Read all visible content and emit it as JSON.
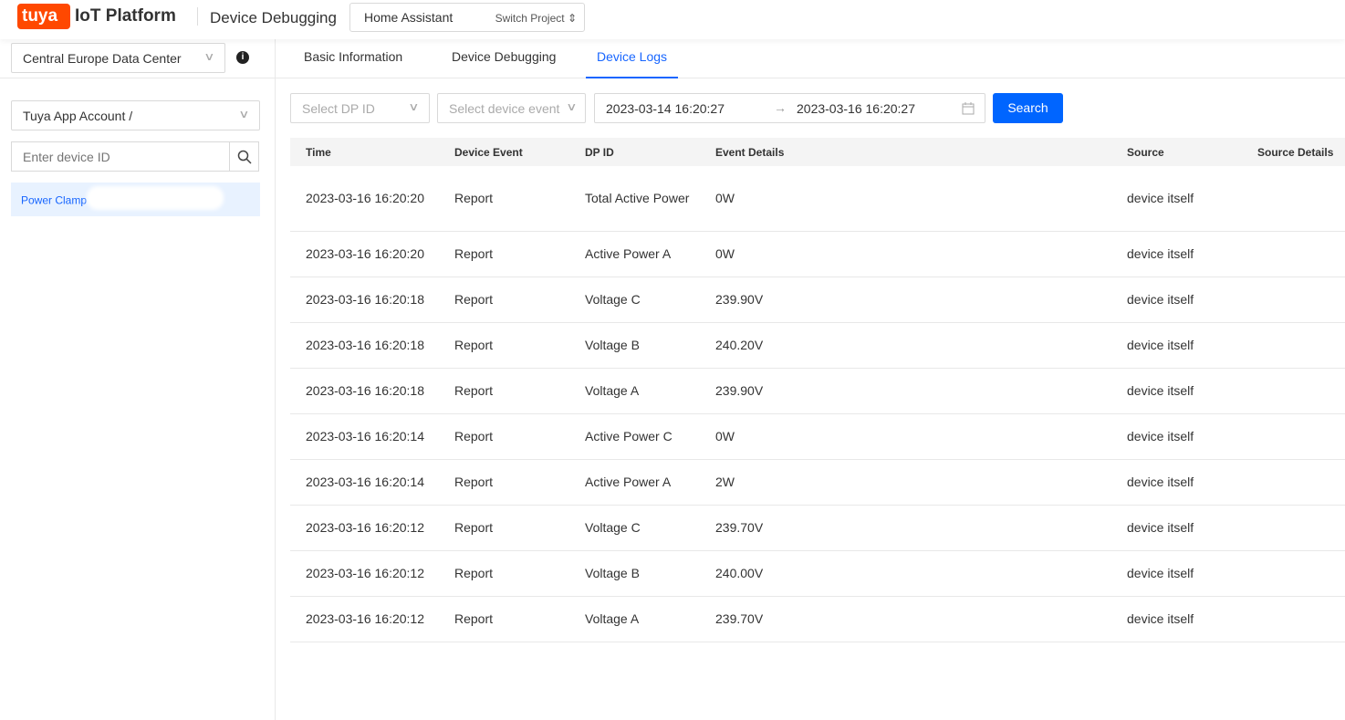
{
  "header": {
    "logo_text": "tuya",
    "brand": "IoT Platform",
    "page_title": "Device Debugging",
    "project": "Home Assistant",
    "switch_label": "Switch Project"
  },
  "sidebar": {
    "data_center": "Central Europe Data Center",
    "account": "Tuya App Account /",
    "device_id_placeholder": "Enter device ID",
    "device": "Power Clamp"
  },
  "tabs": [
    {
      "label": "Basic Information"
    },
    {
      "label": "Device Debugging"
    },
    {
      "label": "Device Logs"
    }
  ],
  "filters": {
    "dp_placeholder": "Select DP ID",
    "event_placeholder": "Select device event",
    "start": "2023-03-14 16:20:27",
    "end": "2023-03-16 16:20:27",
    "search": "Search"
  },
  "table": {
    "columns": [
      "Time",
      "Device Event",
      "DP ID",
      "Event Details",
      "Source",
      "Source Details"
    ],
    "rows": [
      [
        "2023-03-16 16:20:20",
        "Report",
        "Total Active Power",
        "0W",
        "device itself",
        ""
      ],
      [
        "2023-03-16 16:20:20",
        "Report",
        "Active Power A",
        "0W",
        "device itself",
        ""
      ],
      [
        "2023-03-16 16:20:18",
        "Report",
        "Voltage C",
        "239.90V",
        "device itself",
        ""
      ],
      [
        "2023-03-16 16:20:18",
        "Report",
        "Voltage B",
        "240.20V",
        "device itself",
        ""
      ],
      [
        "2023-03-16 16:20:18",
        "Report",
        "Voltage A",
        "239.90V",
        "device itself",
        ""
      ],
      [
        "2023-03-16 16:20:14",
        "Report",
        "Active Power C",
        "0W",
        "device itself",
        ""
      ],
      [
        "2023-03-16 16:20:14",
        "Report",
        "Active Power A",
        "2W",
        "device itself",
        ""
      ],
      [
        "2023-03-16 16:20:12",
        "Report",
        "Voltage C",
        "239.70V",
        "device itself",
        ""
      ],
      [
        "2023-03-16 16:20:12",
        "Report",
        "Voltage B",
        "240.00V",
        "device itself",
        ""
      ],
      [
        "2023-03-16 16:20:12",
        "Report",
        "Voltage A",
        "239.70V",
        "device itself",
        ""
      ]
    ]
  }
}
